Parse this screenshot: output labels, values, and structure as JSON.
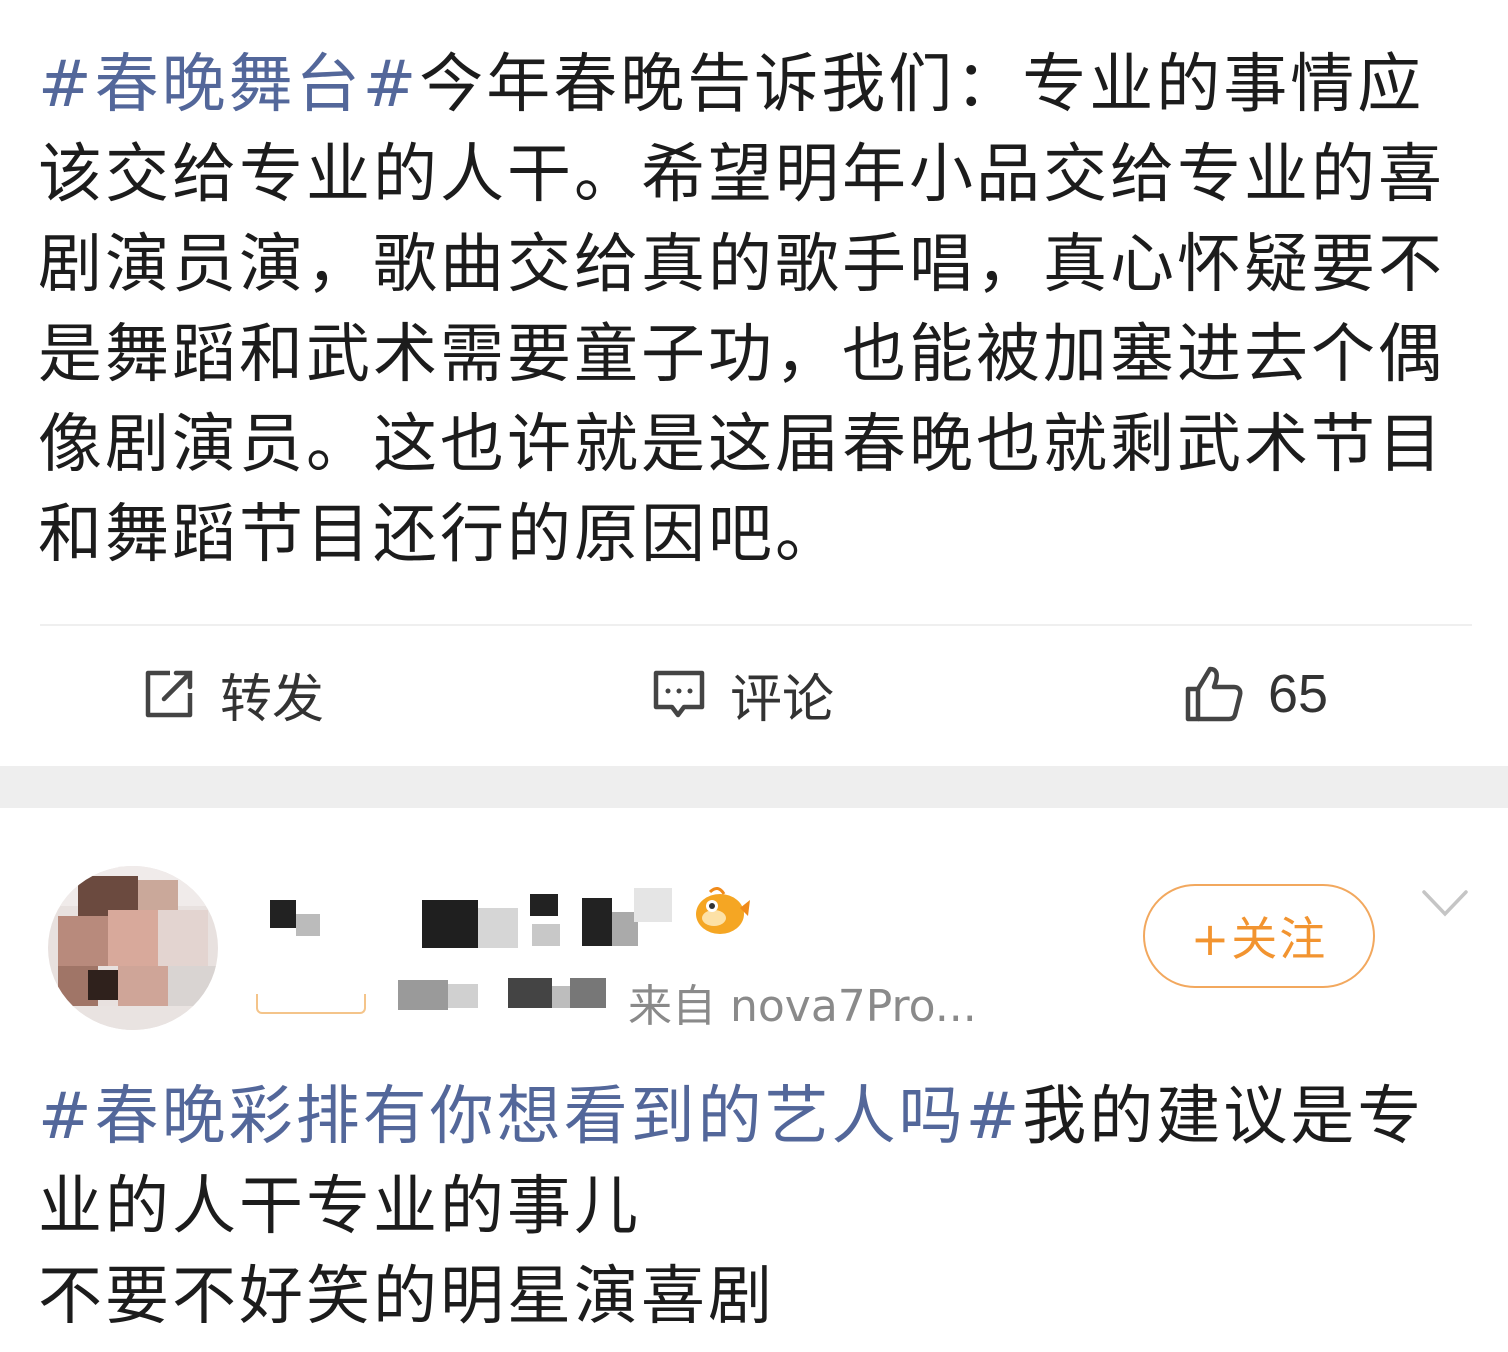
{
  "post1": {
    "topic": "#春晚舞台#",
    "body": "今年春晚告诉我们：专业的事情应该交给专业的人干。希望明年小品交给专业的喜剧演员演，歌曲交给真的歌手唱，真心怀疑要不是舞蹈和武术需要童子功，也能被加塞进去个偶像剧演员。这也许就是这届春晚也就剩武术节目和舞蹈节目还行的原因吧。"
  },
  "actions": {
    "repost_label": "转发",
    "comment_label": "评论",
    "like_count": "65"
  },
  "post2": {
    "follow_label": "+关注",
    "source": "来自 nova7Pro...",
    "topic": "#春晚彩排有你想看到的艺人吗#",
    "body_line1": "我的建议是专业的人干专业的事儿",
    "body_line2": "不要不好笑的明星演喜剧"
  },
  "colors": {
    "topic": "#53679a",
    "follow": "#f29430",
    "separator": "#eeeeee"
  },
  "icons": [
    "repost-icon",
    "comment-icon",
    "like-icon",
    "chevron-down-icon",
    "vip-fish-badge-icon"
  ]
}
